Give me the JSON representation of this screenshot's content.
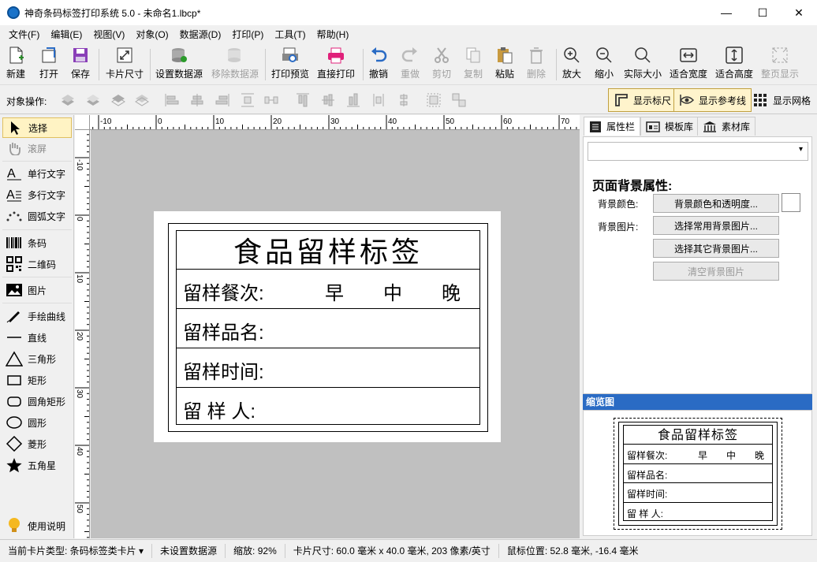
{
  "window": {
    "title": "神奇条码标签打印系统 5.0 - 未命名1.lbcp*",
    "minimize": "—",
    "maximize": "☐",
    "close": "✕"
  },
  "menu": [
    "文件(F)",
    "编辑(E)",
    "视图(V)",
    "对象(O)",
    "数据源(D)",
    "打印(P)",
    "工具(T)",
    "帮助(H)"
  ],
  "toolbar": {
    "new": "新建",
    "open": "打开",
    "save": "保存",
    "card_size": "卡片尺寸",
    "set_datasource": "设置数据源",
    "remove_datasource": "移除数据源",
    "print_preview": "打印预览",
    "direct_print": "直接打印",
    "undo": "撤销",
    "redo": "重做",
    "cut": "剪切",
    "copy": "复制",
    "paste": "粘贴",
    "delete": "删除",
    "zoom_in": "放大",
    "zoom_out": "缩小",
    "actual_size": "实际大小",
    "fit_width": "适合宽度",
    "fit_height": "适合高度",
    "fit_page": "整页显示"
  },
  "objbar": {
    "label": "对象操作:",
    "show_ruler": "显示标尺",
    "show_guides": "显示参考线",
    "show_grid": "显示网格"
  },
  "tools": {
    "select": "选择",
    "scroll": "滚屏",
    "single_text": "单行文字",
    "multi_text": "多行文字",
    "arc_text": "圆弧文字",
    "barcode": "条码",
    "qrcode": "二维码",
    "image": "图片",
    "freehand": "手绘曲线",
    "line": "直线",
    "triangle": "三角形",
    "rect": "矩形",
    "round_rect": "圆角矩形",
    "circle": "圆形",
    "diamond": "菱形",
    "star": "五角星",
    "help": "使用说明"
  },
  "ruler": {
    "top": [
      "-10",
      "0",
      "10",
      "20",
      "30",
      "40",
      "50",
      "60",
      "70"
    ],
    "left": [
      "-10",
      "0",
      "10",
      "20",
      "30",
      "40",
      "50"
    ]
  },
  "label": {
    "title": "食品留样标签",
    "row1_label": "留样餐次:",
    "row1_opts": [
      "早",
      "中",
      "晚"
    ],
    "row2_label": "留样品名:",
    "row3_label": "留样时间:",
    "row4_label": "留 样 人:"
  },
  "right": {
    "tab_props": "属性栏",
    "tab_templates": "模板库",
    "tab_assets": "素材库",
    "section_title": "页面背景属性:",
    "bg_color_label": "背景颜色:",
    "bg_color_btn": "背景颜色和透明度...",
    "bg_image_label": "背景图片:",
    "bg_common_btn": "选择常用背景图片...",
    "bg_other_btn": "选择其它背景图片...",
    "bg_clear_btn": "清空背景图片",
    "preview_title": "缩览图"
  },
  "status": {
    "card_type": "当前卡片类型: 条码标签类卡片 ▾",
    "datasource": "未设置数据源",
    "zoom": "缩放: 92%",
    "card_size": "卡片尺寸: 60.0 毫米 x 40.0 毫米, 203 像素/英寸",
    "mouse_pos": "鼠标位置: 52.8 毫米, -16.4 毫米"
  }
}
